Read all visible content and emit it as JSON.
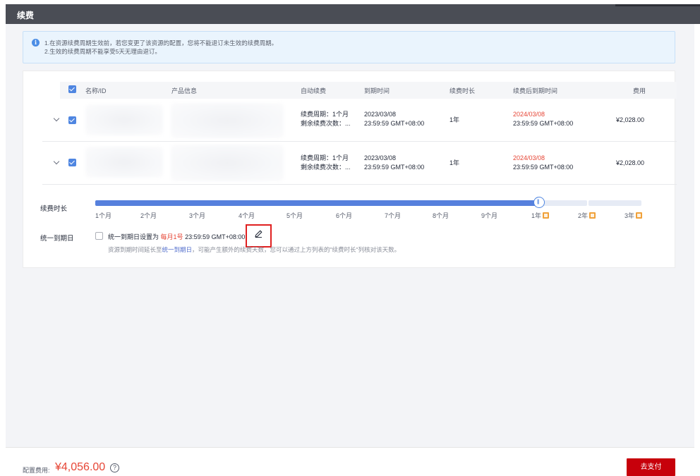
{
  "dialog": {
    "title": "续费"
  },
  "notice": {
    "line1": "1.在资源续费周期生效前，若您变更了该资源的配置，您将不能退订未生效的续费周期。",
    "line2": "2.生效的续费周期不能享受5天无理由退订。"
  },
  "table": {
    "headers": {
      "name": "名称/ID",
      "product": "产品信息",
      "auto_renew": "自动续费",
      "expire": "到期时间",
      "duration": "续费时长",
      "new_expire": "续费后到期时间",
      "fee": "费用"
    },
    "rows": [
      {
        "auto_line1": "续费周期：1个月",
        "auto_line2": "剩余续费次数：...",
        "expire_date": "2023/03/08",
        "expire_time": "23:59:59 GMT+08:00",
        "duration": "1年",
        "new_date": "2024/03/08",
        "new_time": "23:59:59 GMT+08:00",
        "fee": "¥2,028.00"
      },
      {
        "auto_line1": "续费周期：1个月",
        "auto_line2": "剩余续费次数：...",
        "expire_date": "2023/03/08",
        "expire_time": "23:59:59 GMT+08:00",
        "duration": "1年",
        "new_date": "2024/03/08",
        "new_time": "23:59:59 GMT+08:00",
        "fee": "¥2,028.00"
      }
    ]
  },
  "renewal": {
    "label": "续费时长",
    "options": [
      "1个月",
      "2个月",
      "3个月",
      "4个月",
      "5个月",
      "6个月",
      "7个月",
      "8个月",
      "9个月",
      "1年",
      "2年",
      "3年"
    ],
    "selected": "1年",
    "handle_glyph": "|||"
  },
  "unified": {
    "label": "统一到期日",
    "checkbox_text": "统一到期日设置为",
    "date_highlight": "每月1号",
    "time": "23:59:59 GMT+08:00",
    "hint_before": "资源到期时间延长至",
    "hint_link": "统一到期日",
    "hint_after": "，可能产生额外的续费天数，您可以通过上方列表的\"续费时长\"列核对该天数。"
  },
  "footer": {
    "cost_label": "配置费用:",
    "cost_value": "¥4,056.00",
    "help_glyph": "?",
    "pay_button": "去支付"
  },
  "colors": {
    "accent": "#4f86e1",
    "price_red": "#e64535",
    "pay_button": "#c7000b"
  }
}
